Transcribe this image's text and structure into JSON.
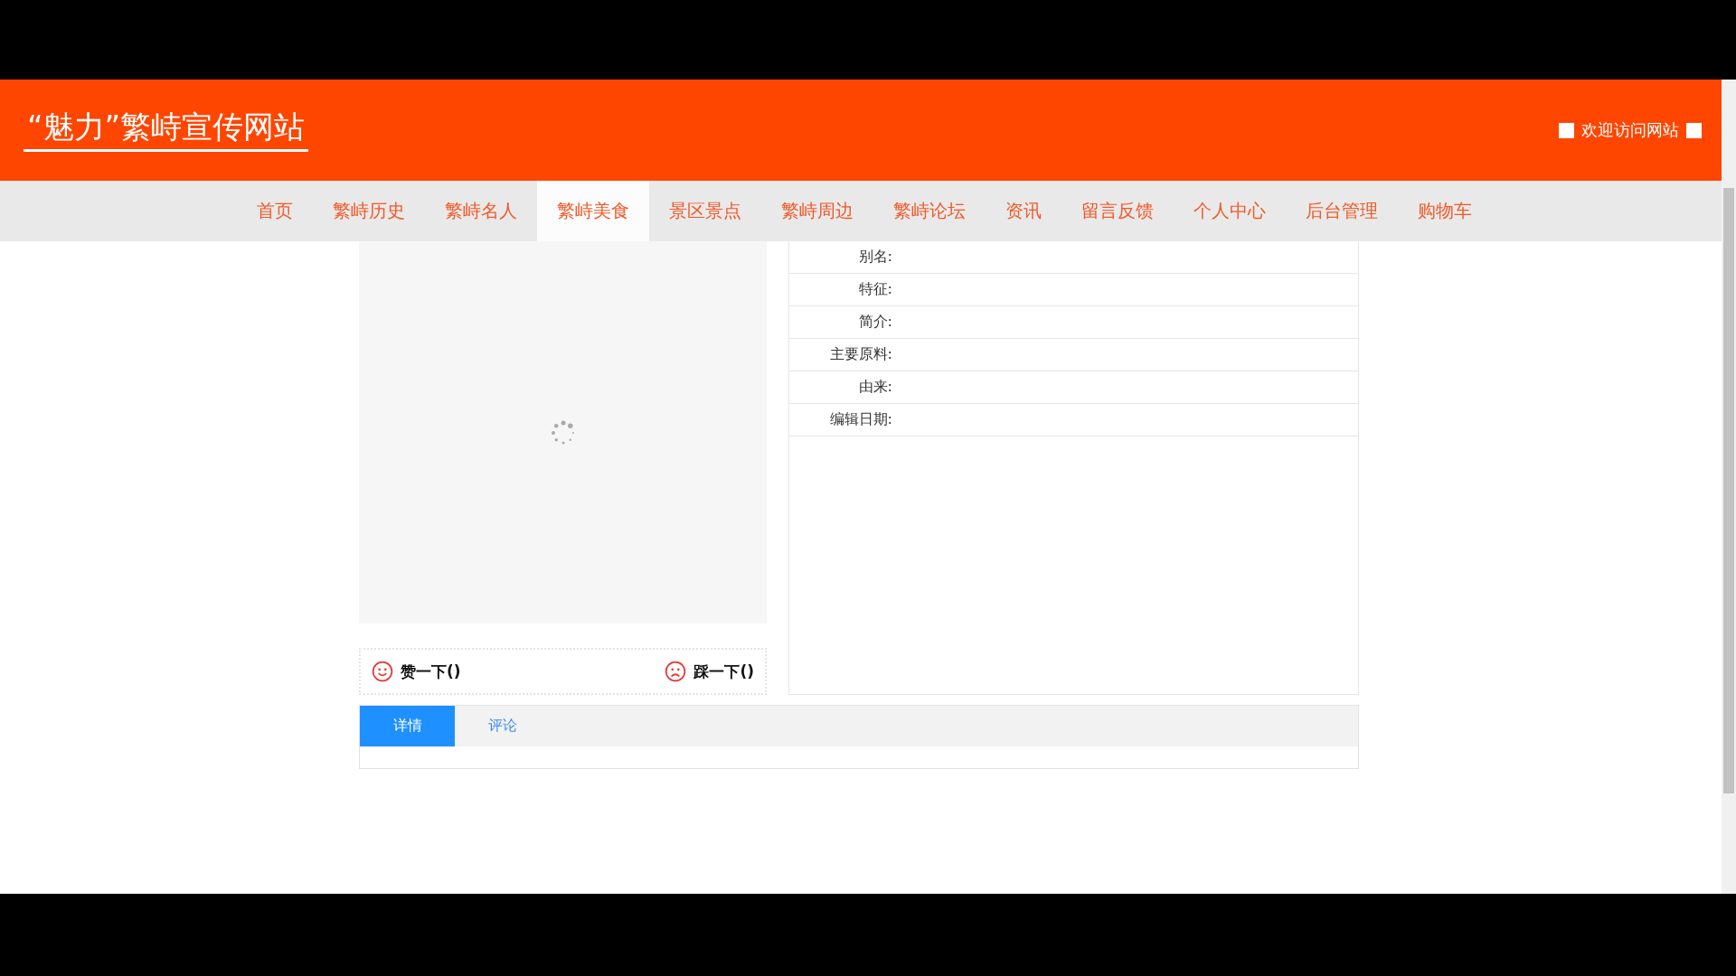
{
  "header": {
    "site_title": "“魅力”繁峙宣传网站",
    "welcome": "欢迎访问网站"
  },
  "nav": [
    {
      "label": "首页",
      "selected": false
    },
    {
      "label": "繁峙历史",
      "selected": false
    },
    {
      "label": "繁峙名人",
      "selected": false
    },
    {
      "label": "繁峙美食",
      "selected": true
    },
    {
      "label": "景区景点",
      "selected": false
    },
    {
      "label": "繁峙周边",
      "selected": false
    },
    {
      "label": "繁峙论坛",
      "selected": false
    },
    {
      "label": "资讯",
      "selected": false
    },
    {
      "label": "留言反馈",
      "selected": false
    },
    {
      "label": "个人中心",
      "selected": false
    },
    {
      "label": "后台管理",
      "selected": false
    },
    {
      "label": "购物车",
      "selected": false
    }
  ],
  "detail_fields": [
    {
      "label": "别名:"
    },
    {
      "label": "特征:"
    },
    {
      "label": "简介:"
    },
    {
      "label": "主要原料:"
    },
    {
      "label": "由来:"
    },
    {
      "label": "编辑日期:"
    }
  ],
  "votes": [
    {
      "kind": "like",
      "label": "赞一下()"
    },
    {
      "kind": "dislike",
      "label": "踩一下()"
    }
  ],
  "tabs": [
    {
      "label": "详情",
      "selected": true
    },
    {
      "label": "评论",
      "selected": false
    }
  ]
}
